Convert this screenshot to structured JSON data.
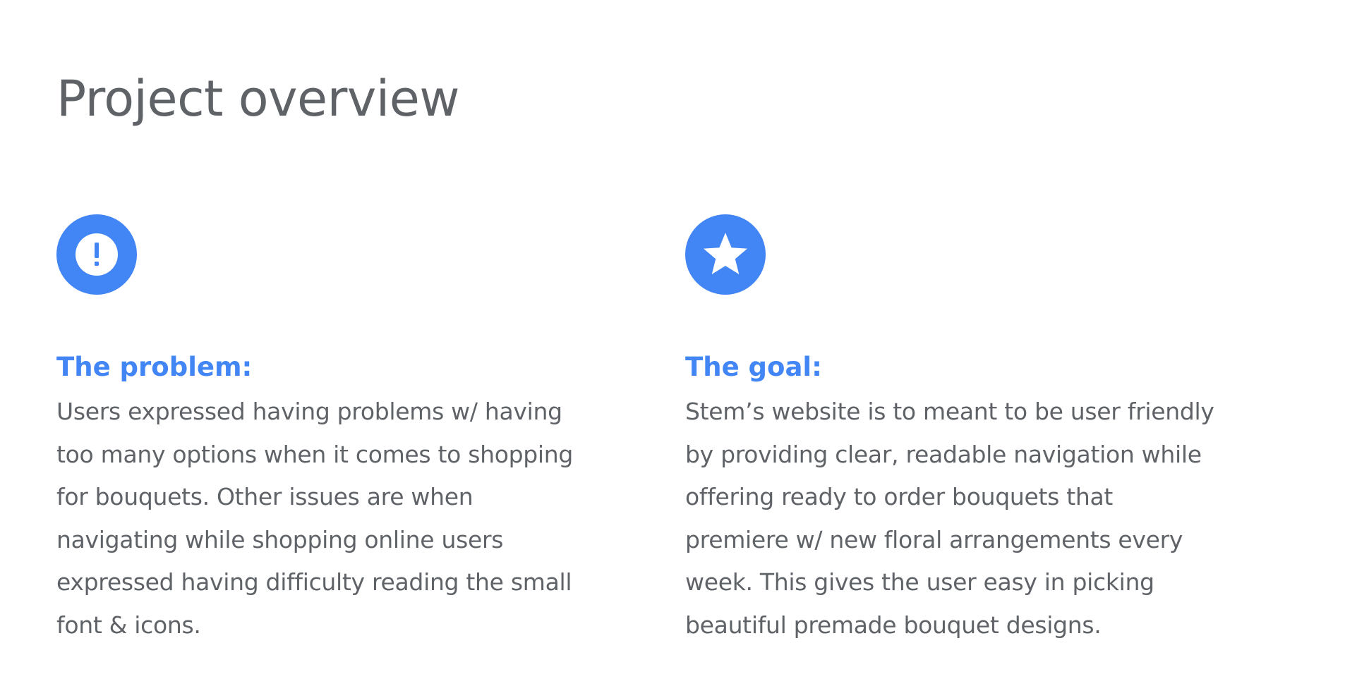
{
  "page": {
    "title": "Project overview",
    "accent_color": "#4285f4",
    "text_color": "#5f6368"
  },
  "problem": {
    "icon": "exclamation-icon",
    "heading": "The problem:",
    "body": "Users expressed having problems w/ having too many options when it comes to shopping for bouquets. Other issues are when navigating while shopping online users expressed having difficulty reading the small font & icons."
  },
  "goal": {
    "icon": "star-icon",
    "heading": "The goal:",
    "body": "Stem’s website is to meant to be user friendly by providing clear, readable navigation while offering ready to order bouquets that premiere w/ new floral arrangements every week. This gives the user easy in picking beautiful premade bouquet designs."
  }
}
